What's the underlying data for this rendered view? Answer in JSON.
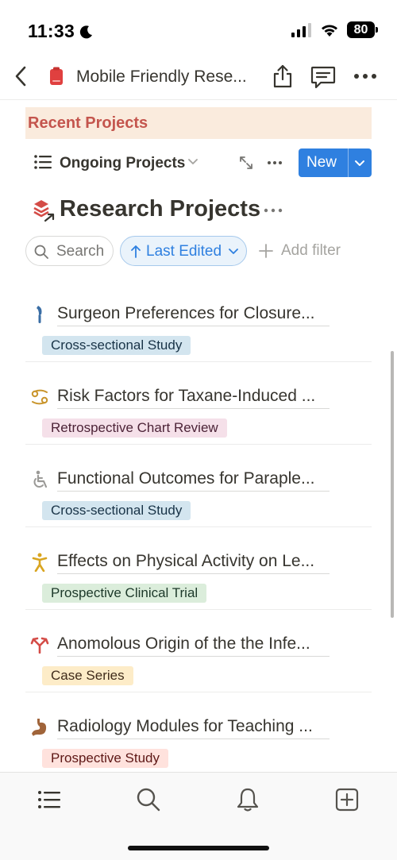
{
  "status_bar": {
    "time": "11:33",
    "battery": "80"
  },
  "nav": {
    "title": "Mobile Friendly Rese..."
  },
  "recent": {
    "title": "Recent Projects"
  },
  "view": {
    "name": "Ongoing Projects",
    "new_label": "New"
  },
  "database": {
    "title": "Research Projects"
  },
  "filters": {
    "search_label": "Search",
    "sort_label": "Last Edited",
    "add_filter_label": "Add filter"
  },
  "projects": [
    {
      "title": "Surgeon Preferences for Closure...",
      "icon": "scalpel-icon",
      "tag": "Cross-sectional Study",
      "tag_bg": "#d3e5ef",
      "tag_color": "#183347"
    },
    {
      "title": "Risk Factors for Taxane-Induced ...",
      "icon": "cancer-sign-icon",
      "tag": "Retrospective Chart Review",
      "tag_bg": "#f5e0e9",
      "tag_color": "#4c2337"
    },
    {
      "title": "Functional Outcomes for Paraple...",
      "icon": "wheelchair-icon",
      "tag": "Cross-sectional Study",
      "tag_bg": "#d3e5ef",
      "tag_color": "#183347"
    },
    {
      "title": "Effects on Physical Activity on Le...",
      "icon": "figure-icon",
      "tag": "Prospective Clinical Trial",
      "tag_bg": "#dbeddb",
      "tag_color": "#1c3829"
    },
    {
      "title": "Anomolous Origin of the the Infe...",
      "icon": "artery-icon",
      "tag": "Case Series",
      "tag_bg": "#fdecc8",
      "tag_color": "#402c1b"
    },
    {
      "title": "Radiology Modules for Teaching ...",
      "icon": "stomach-icon",
      "tag": "Prospective Study",
      "tag_bg": "#ffe2dd",
      "tag_color": "#5d1715"
    }
  ],
  "tab_bar": {
    "items": [
      "list-icon",
      "search-icon",
      "bell-icon",
      "add-page-icon"
    ]
  },
  "colors": {
    "accent": "#2f80e0",
    "callout_bg": "#faebdd",
    "callout_text": "#c4554d"
  }
}
